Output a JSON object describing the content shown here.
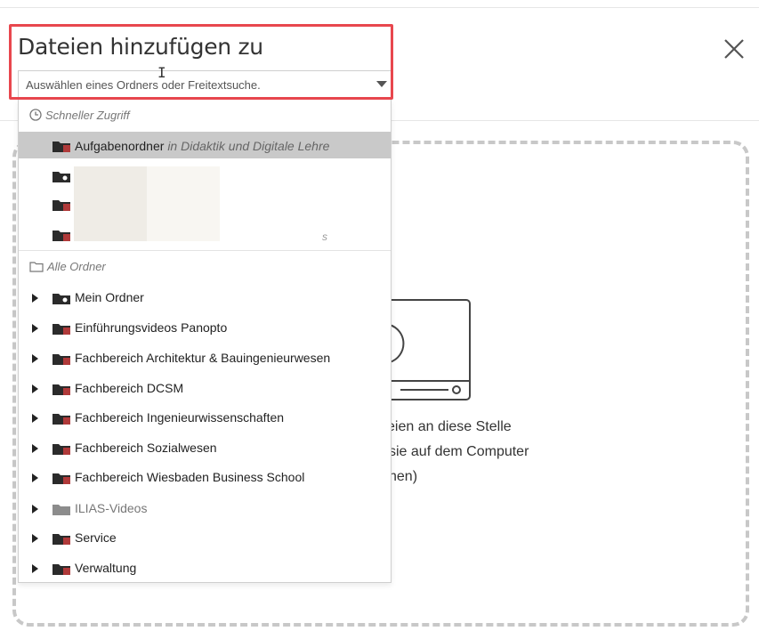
{
  "dialog": {
    "title": "Dateien hinzufügen zu",
    "close_label": "Schließen"
  },
  "select": {
    "placeholder": "Auswählen eines Ordners oder Freitextsuche."
  },
  "dropzone": {
    "line1": "eien an diese Stelle",
    "line2": "sie auf dem Computer",
    "line3": "hen)"
  },
  "dropdown": {
    "quick_access": {
      "label": "Schneller Zugriff",
      "items": [
        {
          "name": "Aufgabenordner",
          "context": "in Didaktik und Digitale Lehre",
          "icon": "folder-red-icon"
        },
        {
          "name": "",
          "icon": "folder-star-icon"
        },
        {
          "name": "",
          "icon": "folder-red-icon"
        },
        {
          "name": "",
          "icon": "folder-red-icon",
          "suffix": "s"
        }
      ]
    },
    "all_folders": {
      "label": "Alle Ordner",
      "items": [
        {
          "name": "Mein Ordner",
          "icon": "folder-star-icon"
        },
        {
          "name": "Einführungsvideos Panopto",
          "icon": "folder-red-icon"
        },
        {
          "name": "Fachbereich Architektur & Bauingenieurwesen",
          "icon": "folder-red-icon"
        },
        {
          "name": "Fachbereich DCSM",
          "icon": "folder-red-icon"
        },
        {
          "name": "Fachbereich Ingenieurwissenschaften",
          "icon": "folder-red-icon"
        },
        {
          "name": "Fachbereich Sozialwesen",
          "icon": "folder-red-icon"
        },
        {
          "name": "Fachbereich Wiesbaden Business School",
          "icon": "folder-red-icon"
        },
        {
          "name": "ILIAS-Videos",
          "icon": "folder-gray-icon"
        },
        {
          "name": "Service",
          "icon": "folder-red-icon"
        },
        {
          "name": "Verwaltung",
          "icon": "folder-red-icon"
        }
      ]
    }
  },
  "colors": {
    "highlight": "#e8474e",
    "folder": "#2b2b2b",
    "folder_accent": "#b03a3a",
    "selected_row": "#c9c9c9"
  }
}
